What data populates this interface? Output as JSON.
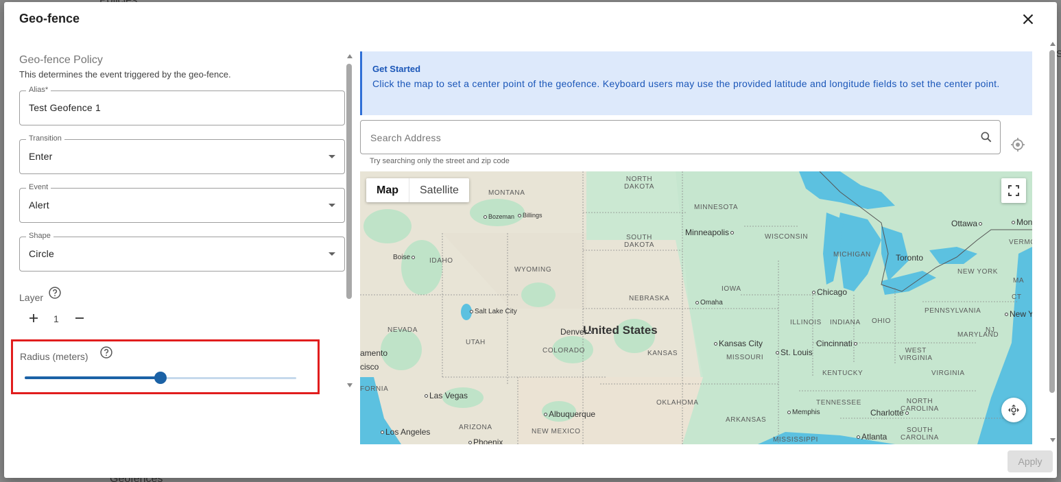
{
  "background": {
    "top_text": "Policies",
    "bottom_text": "Geofences",
    "right_text": "S"
  },
  "dialog": {
    "title": "Geo-fence",
    "policy": {
      "title": "Geo-fence Policy",
      "description": "This determines the event triggered by the geo-fence.",
      "alias": {
        "label": "Alias*",
        "value": "Test Geofence 1"
      },
      "transition": {
        "label": "Transition",
        "value": "Enter"
      },
      "event": {
        "label": "Event",
        "value": "Alert"
      },
      "shape": {
        "label": "Shape",
        "value": "Circle"
      },
      "layer": {
        "label": "Layer",
        "value": "1"
      },
      "radius": {
        "label": "Radius (meters)",
        "fraction": 0.5
      }
    },
    "banner": {
      "title": "Get Started",
      "text": "Click the map to set a center point of the geofence. Keyboard users may use the provided latitude and longitude fields to set the center point."
    },
    "search": {
      "placeholder": "Search Address",
      "hint": "Try searching only the street and zip code"
    },
    "map": {
      "type_map": "Map",
      "type_satellite": "Satellite",
      "country": "United States",
      "states": [
        {
          "name": "NORTH",
          "line2": "DAKOTA"
        },
        {
          "name": "MONTANA"
        },
        {
          "name": "MINNESOTA"
        },
        {
          "name": "SOUTH",
          "line2": "DAKOTA"
        },
        {
          "name": "WISCONSIN"
        },
        {
          "name": "MICHIGAN"
        },
        {
          "name": "IDAHO"
        },
        {
          "name": "WYOMING"
        },
        {
          "name": "IOWA"
        },
        {
          "name": "NEBRASKA"
        },
        {
          "name": "NEVADA"
        },
        {
          "name": "UTAH"
        },
        {
          "name": "COLORADO"
        },
        {
          "name": "KANSAS"
        },
        {
          "name": "ILLINOIS"
        },
        {
          "name": "INDIANA"
        },
        {
          "name": "OHIO"
        },
        {
          "name": "PENNSYLVANIA"
        },
        {
          "name": "NEW YORK"
        },
        {
          "name": "MISSOURI"
        },
        {
          "name": "KENTUCKY"
        },
        {
          "name": "WEST",
          "line2": "VIRGINIA"
        },
        {
          "name": "VIRGINIA"
        },
        {
          "name": "MARYLAND"
        },
        {
          "name": "OKLAHOMA"
        },
        {
          "name": "TENNESSEE"
        },
        {
          "name": "NORTH",
          "line2": "CAROLINA"
        },
        {
          "name": "ARIZONA"
        },
        {
          "name": "NEW MEXICO"
        },
        {
          "name": "ARKANSAS"
        },
        {
          "name": "MISSISSIPPI"
        },
        {
          "name": "SOUTH",
          "line2": "CAROLINA"
        },
        {
          "name": "FORNIA"
        },
        {
          "name": "VERMO"
        },
        {
          "name": "NJ"
        },
        {
          "name": "CT"
        },
        {
          "name": "MA"
        }
      ],
      "cities": [
        "Bozeman",
        "Billings",
        "Minneapolis",
        "Ottawa",
        "Mont",
        "Toronto",
        "Boise",
        "Chicago",
        "Omaha",
        "New Yo",
        "Salt Lake City",
        "Denver",
        "Kansas City",
        "Cincinnati",
        "St. Louis",
        "amento",
        "cisco",
        "Las Vegas",
        "Albuquerque",
        "Memphis",
        "Charlotte",
        "Los Angeles",
        "Phoenix",
        "Atlanta"
      ]
    },
    "apply_label": "Apply"
  }
}
